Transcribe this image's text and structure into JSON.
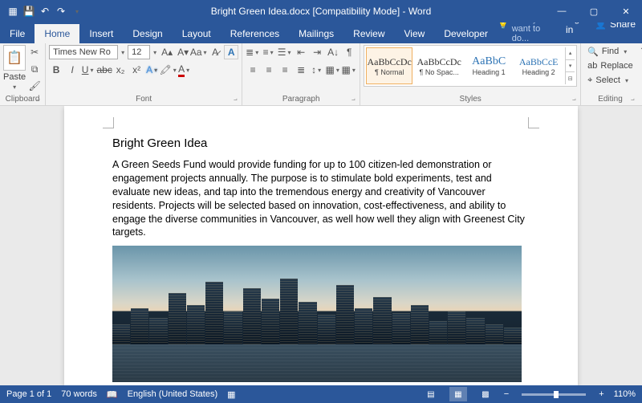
{
  "titlebar": {
    "doc_title": "Bright Green Idea.docx [Compatibility Mode] - Word"
  },
  "menu": {
    "file": "File",
    "tabs": [
      "Home",
      "Insert",
      "Design",
      "Layout",
      "References",
      "Mailings",
      "Review",
      "View",
      "Developer"
    ],
    "active": "Home",
    "tell_me": "Tell me what you want to do...",
    "sign_in": "Sign in",
    "share": "Share"
  },
  "ribbon": {
    "clipboard": {
      "paste": "Paste",
      "label": "Clipboard"
    },
    "font": {
      "name": "Times New Ro",
      "size": "12",
      "label": "Font"
    },
    "paragraph": {
      "label": "Paragraph"
    },
    "styles": {
      "label": "Styles",
      "items": [
        {
          "preview": "AaBbCcDc",
          "name": "¶ Normal"
        },
        {
          "preview": "AaBbCcDc",
          "name": "¶ No Spac..."
        },
        {
          "preview": "AaBbC",
          "name": "Heading 1"
        },
        {
          "preview": "AaBbCcE",
          "name": "Heading 2"
        }
      ]
    },
    "editing": {
      "find": "Find",
      "replace": "Replace",
      "select": "Select",
      "label": "Editing"
    }
  },
  "document": {
    "title": "Bright Green Idea",
    "body": "A Green Seeds Fund would provide funding for up to 100 citizen-led demonstration or engagement projects annually. The purpose is to stimulate bold experiments, test and evaluate new ideas, and tap into the tremendous energy and creativity of Vancouver residents. Projects will be selected based on innovation, cost-effectiveness, and ability to engage the diverse communities in Vancouver, as well how well they align with Greenest City targets."
  },
  "statusbar": {
    "page": "Page 1 of 1",
    "words": "70 words",
    "language": "English (United States)",
    "zoom": "110%"
  }
}
